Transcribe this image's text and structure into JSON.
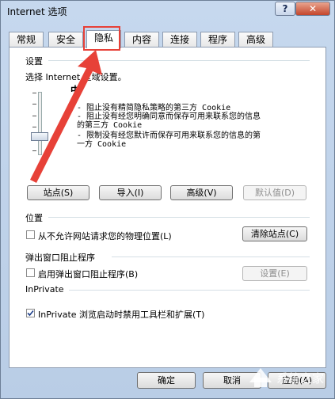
{
  "window": {
    "title": "Internet 选项",
    "help": "?",
    "close": "✕"
  },
  "tabs": [
    "常规",
    "安全",
    "隐私",
    "内容",
    "连接",
    "程序",
    "高级"
  ],
  "settings": {
    "group": "设置",
    "prompt": "选择 Internet 区域设置。",
    "level_glyph": "中",
    "descriptions": [
      "- 阻止没有精简隐私策略的第三方 Cookie",
      "- 阻止没有经您明确同意而保存可用来联系您的信息",
      "  的第三方 Cookie",
      "- 限制没有经您默许而保存可用来联系您的信息的第",
      "  一方 Cookie"
    ],
    "buttons": {
      "sites": "站点(S)",
      "import": "导入(I)",
      "advanced": "高级(V)",
      "default": "默认值(D)"
    }
  },
  "location": {
    "group": "位置",
    "checkbox": "从不允许网站请求您的物理位置(L)",
    "clear": "清除站点(C)"
  },
  "popup": {
    "group": "弹出窗口阻止程序",
    "checkbox": "启用弹出窗口阻止程序(B)",
    "settings": "设置(E)"
  },
  "inprivate": {
    "group": "InPrivate",
    "checkbox": "InPrivate 浏览启动时禁用工具栏和扩展(T)",
    "checked": true
  },
  "footer": {
    "ok": "确定",
    "cancel": "取消",
    "apply": "应用(A)"
  },
  "watermark": {
    "text": "系统之家"
  },
  "colors": {
    "highlight": "#e74138"
  }
}
